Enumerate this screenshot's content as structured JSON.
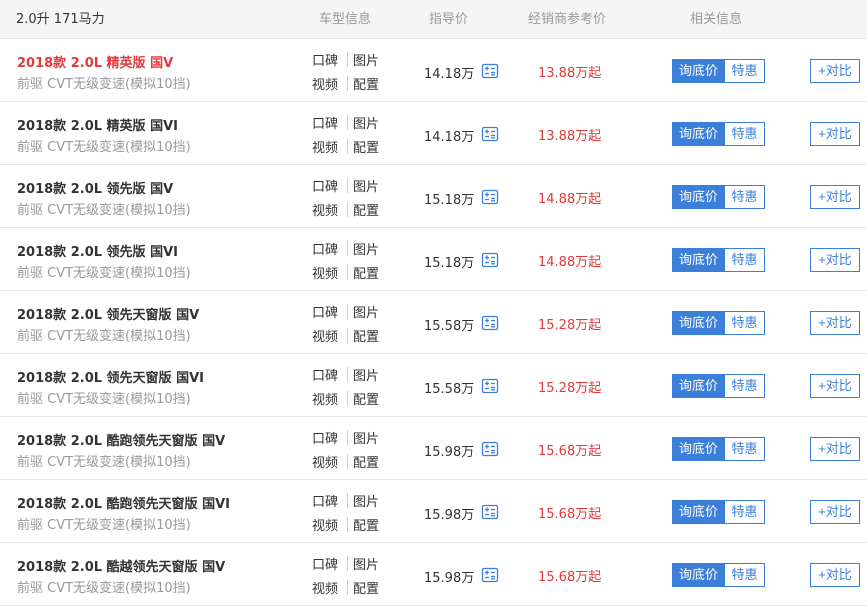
{
  "header": {
    "spec": "2.0升 171马力",
    "info": "车型信息",
    "guide_price": "指导价",
    "dealer_price": "经销商参考价",
    "related": "相关信息"
  },
  "labels": {
    "koubei": "口碑",
    "tupian": "图片",
    "shipin": "视频",
    "peizhi": "配置",
    "ask_price": "询底价",
    "promo": "特惠",
    "compare": "+对比"
  },
  "icons": {
    "calculator": "calculator-icon"
  },
  "colors": {
    "accent": "#3b7fd9",
    "price_red": "#e4393c",
    "highlight_name": "#e4393c"
  },
  "rows": [
    {
      "name": "2018款 2.0L 精英版 国V",
      "transmission": "前驱 CVT无级变速(模拟10挡)",
      "guide": "14.18万",
      "dealer": "13.88万起",
      "highlight": true
    },
    {
      "name": "2018款 2.0L 精英版 国VI",
      "transmission": "前驱 CVT无级变速(模拟10挡)",
      "guide": "14.18万",
      "dealer": "13.88万起",
      "highlight": false
    },
    {
      "name": "2018款 2.0L 领先版 国V",
      "transmission": "前驱 CVT无级变速(模拟10挡)",
      "guide": "15.18万",
      "dealer": "14.88万起",
      "highlight": false
    },
    {
      "name": "2018款 2.0L 领先版 国VI",
      "transmission": "前驱 CVT无级变速(模拟10挡)",
      "guide": "15.18万",
      "dealer": "14.88万起",
      "highlight": false
    },
    {
      "name": "2018款 2.0L 领先天窗版 国V",
      "transmission": "前驱 CVT无级变速(模拟10挡)",
      "guide": "15.58万",
      "dealer": "15.28万起",
      "highlight": false
    },
    {
      "name": "2018款 2.0L 领先天窗版 国VI",
      "transmission": "前驱 CVT无级变速(模拟10挡)",
      "guide": "15.58万",
      "dealer": "15.28万起",
      "highlight": false
    },
    {
      "name": "2018款 2.0L 酷跑领先天窗版 国V",
      "transmission": "前驱 CVT无级变速(模拟10挡)",
      "guide": "15.98万",
      "dealer": "15.68万起",
      "highlight": false
    },
    {
      "name": "2018款 2.0L 酷跑领先天窗版 国VI",
      "transmission": "前驱 CVT无级变速(模拟10挡)",
      "guide": "15.98万",
      "dealer": "15.68万起",
      "highlight": false
    },
    {
      "name": "2018款 2.0L 酷越领先天窗版 国V",
      "transmission": "前驱 CVT无级变速(模拟10挡)",
      "guide": "15.98万",
      "dealer": "15.68万起",
      "highlight": false
    }
  ]
}
